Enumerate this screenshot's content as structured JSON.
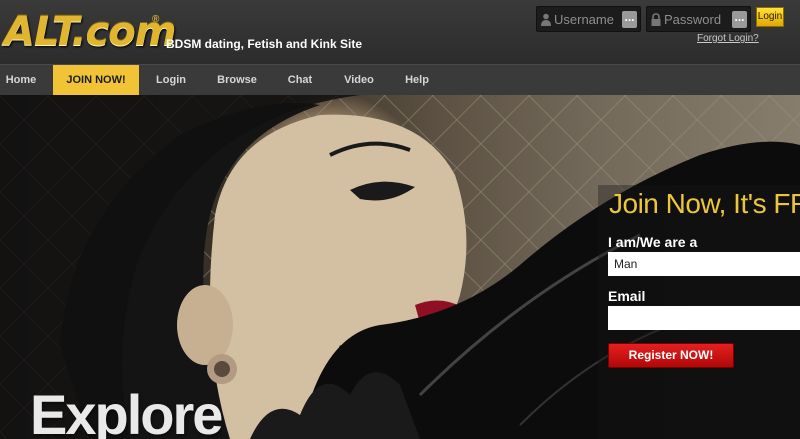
{
  "header": {
    "logo_text": "ALT.com",
    "logo_mark": "®",
    "tagline": "BDSM dating, Fetish and Kink Site",
    "login": {
      "username_placeholder": "Username",
      "password_placeholder": "Password",
      "dots_icon": "...",
      "login_label": "Login",
      "forgot_label": "Forgot Login?"
    }
  },
  "nav": {
    "items": [
      "Home",
      "JOIN NOW!",
      "Login",
      "Browse",
      "Chat",
      "Video",
      "Help"
    ],
    "active": "JOIN NOW!"
  },
  "hero": {
    "headline": "Explore",
    "join": {
      "title": "Join Now, It's FREE!",
      "iam_label": "I am/We are a",
      "iam_value": "Man",
      "email_label": "Email",
      "email_value": "",
      "register_label": "Register NOW!"
    }
  },
  "colors": {
    "accent_gold": "#f1c337",
    "register_red": "#c81010",
    "header_bg": "#333333"
  },
  "icons": {
    "username_field": "user-icon",
    "password_field": "lock-icon"
  }
}
